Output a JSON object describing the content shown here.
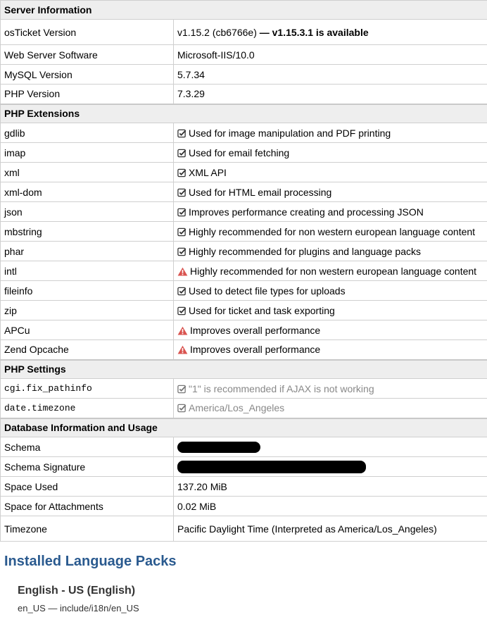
{
  "sections": {
    "server": "Server Information",
    "extensions": "PHP Extensions",
    "settings": "PHP Settings",
    "database": "Database Information and Usage"
  },
  "server": {
    "osticket": {
      "label": "osTicket Version",
      "value": "v1.15.2 (cb6766e)",
      "update": "— v1.15.3.1 is available"
    },
    "webserver": {
      "label": "Web Server Software",
      "value": "Microsoft-IIS/10.0"
    },
    "mysql": {
      "label": "MySQL Version",
      "value": "5.7.34"
    },
    "php": {
      "label": "PHP Version",
      "value": "7.3.29"
    }
  },
  "extensions": [
    {
      "name": "gdlib",
      "status": "ok",
      "desc": "Used for image manipulation and PDF printing"
    },
    {
      "name": "imap",
      "status": "ok",
      "desc": "Used for email fetching"
    },
    {
      "name": "xml",
      "status": "ok",
      "desc": "XML API"
    },
    {
      "name": "xml-dom",
      "status": "ok",
      "desc": "Used for HTML email processing"
    },
    {
      "name": "json",
      "status": "ok",
      "desc": "Improves performance creating and processing JSON"
    },
    {
      "name": "mbstring",
      "status": "ok",
      "desc": "Highly recommended for non western european language content"
    },
    {
      "name": "phar",
      "status": "ok",
      "desc": "Highly recommended for plugins and language packs"
    },
    {
      "name": "intl",
      "status": "warn",
      "desc": "Highly recommended for non western european language content"
    },
    {
      "name": "fileinfo",
      "status": "ok",
      "desc": "Used to detect file types for uploads"
    },
    {
      "name": "zip",
      "status": "ok",
      "desc": "Used for ticket and task exporting"
    },
    {
      "name": "APCu",
      "status": "warn",
      "desc": "Improves overall performance"
    },
    {
      "name": "Zend Opcache",
      "status": "warn",
      "desc": "Improves overall performance"
    }
  ],
  "settings": [
    {
      "name": "cgi.fix_pathinfo",
      "desc": "\"1\" is recommended if AJAX is not working"
    },
    {
      "name": "date.timezone",
      "desc": "America/Los_Angeles"
    }
  ],
  "database": {
    "schema": {
      "label": "Schema"
    },
    "signature": {
      "label": "Schema Signature"
    },
    "space_used": {
      "label": "Space Used",
      "value": "137.20 MiB"
    },
    "space_attach": {
      "label": "Space for Attachments",
      "value": "0.02 MiB"
    },
    "timezone": {
      "label": "Timezone",
      "value": "Pacific Daylight Time (Interpreted as America/Los_Angeles)"
    }
  },
  "language_packs": {
    "title": "Installed Language Packs",
    "items": [
      {
        "name": "English - US (English)",
        "path": "en_US — include/i18n/en_US"
      }
    ]
  },
  "colors": {
    "heading_blue": "#2a5a8f",
    "warn_red": "#d9534f",
    "header_bg": "#eeeeee",
    "muted_text": "#888888"
  },
  "icons": {
    "ok": "check-square-icon",
    "warn": "warning-triangle-icon"
  }
}
